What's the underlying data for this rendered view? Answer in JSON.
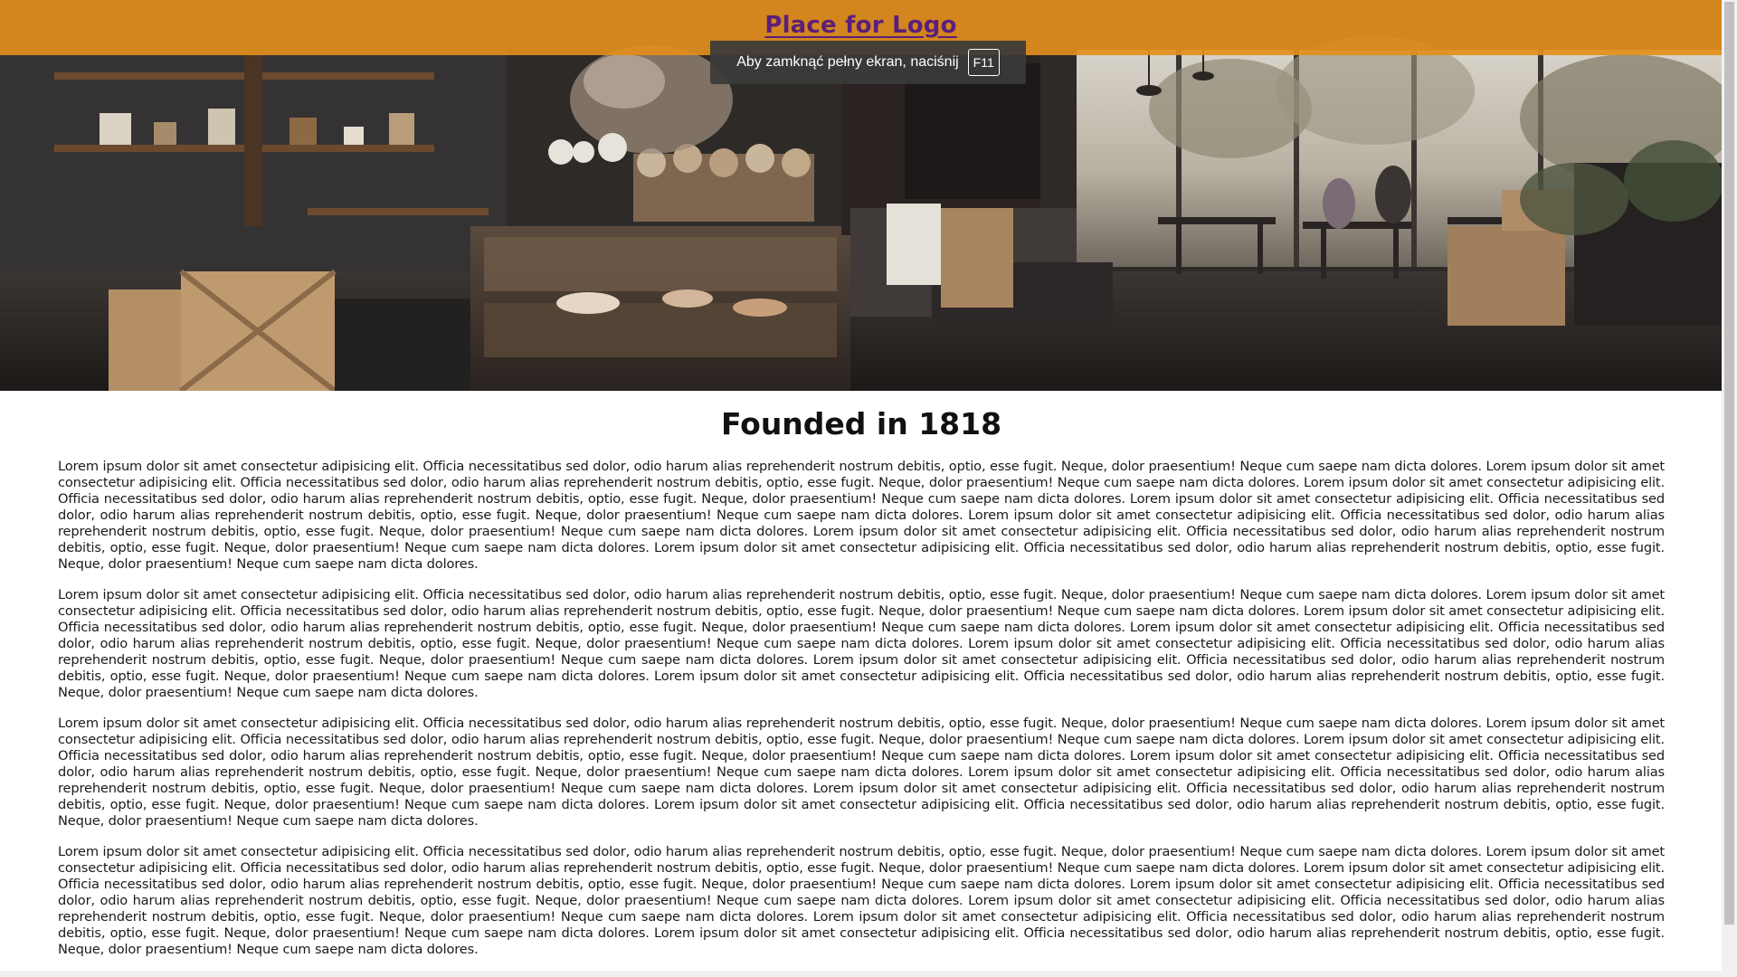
{
  "header": {
    "logo_text": "Place for Logo",
    "bar_color": "#e28e1c",
    "logo_color": "#5b1f7a"
  },
  "fullscreen_notice": {
    "message": "Aby zamknąć pełny ekran, naciśnij",
    "key": "F11"
  },
  "hero": {
    "image_icon": "coffee-shop-interior-image"
  },
  "main": {
    "title": "Founded in 1818",
    "paragraphs": [
      "Lorem ipsum dolor sit amet consectetur adipisicing elit. Officia necessitatibus sed dolor, odio harum alias reprehenderit nostrum debitis, optio, esse fugit. Neque, dolor praesentium! Neque cum saepe nam dicta dolores. Lorem ipsum dolor sit amet consectetur adipisicing elit. Officia necessitatibus sed dolor, odio harum alias reprehenderit nostrum debitis, optio, esse fugit. Neque, dolor praesentium! Neque cum saepe nam dicta dolores. Lorem ipsum dolor sit amet consectetur adipisicing elit. Officia necessitatibus sed dolor, odio harum alias reprehenderit nostrum debitis, optio, esse fugit. Neque, dolor praesentium! Neque cum saepe nam dicta dolores. Lorem ipsum dolor sit amet consectetur adipisicing elit. Officia necessitatibus sed dolor, odio harum alias reprehenderit nostrum debitis, optio, esse fugit. Neque, dolor praesentium! Neque cum saepe nam dicta dolores. Lorem ipsum dolor sit amet consectetur adipisicing elit. Officia necessitatibus sed dolor, odio harum alias reprehenderit nostrum debitis, optio, esse fugit. Neque, dolor praesentium! Neque cum saepe nam dicta dolores. Lorem ipsum dolor sit amet consectetur adipisicing elit. Officia necessitatibus sed dolor, odio harum alias reprehenderit nostrum debitis, optio, esse fugit. Neque, dolor praesentium! Neque cum saepe nam dicta dolores. Lorem ipsum dolor sit amet consectetur adipisicing elit. Officia necessitatibus sed dolor, odio harum alias reprehenderit nostrum debitis, optio, esse fugit. Neque, dolor praesentium! Neque cum saepe nam dicta dolores.",
      "Lorem ipsum dolor sit amet consectetur adipisicing elit. Officia necessitatibus sed dolor, odio harum alias reprehenderit nostrum debitis, optio, esse fugit. Neque, dolor praesentium! Neque cum saepe nam dicta dolores. Lorem ipsum dolor sit amet consectetur adipisicing elit. Officia necessitatibus sed dolor, odio harum alias reprehenderit nostrum debitis, optio, esse fugit. Neque, dolor praesentium! Neque cum saepe nam dicta dolores. Lorem ipsum dolor sit amet consectetur adipisicing elit. Officia necessitatibus sed dolor, odio harum alias reprehenderit nostrum debitis, optio, esse fugit. Neque, dolor praesentium! Neque cum saepe nam dicta dolores. Lorem ipsum dolor sit amet consectetur adipisicing elit. Officia necessitatibus sed dolor, odio harum alias reprehenderit nostrum debitis, optio, esse fugit. Neque, dolor praesentium! Neque cum saepe nam dicta dolores. Lorem ipsum dolor sit amet consectetur adipisicing elit. Officia necessitatibus sed dolor, odio harum alias reprehenderit nostrum debitis, optio, esse fugit. Neque, dolor praesentium! Neque cum saepe nam dicta dolores. Lorem ipsum dolor sit amet consectetur adipisicing elit. Officia necessitatibus sed dolor, odio harum alias reprehenderit nostrum debitis, optio, esse fugit. Neque, dolor praesentium! Neque cum saepe nam dicta dolores. Lorem ipsum dolor sit amet consectetur adipisicing elit. Officia necessitatibus sed dolor, odio harum alias reprehenderit nostrum debitis, optio, esse fugit. Neque, dolor praesentium! Neque cum saepe nam dicta dolores.",
      "Lorem ipsum dolor sit amet consectetur adipisicing elit. Officia necessitatibus sed dolor, odio harum alias reprehenderit nostrum debitis, optio, esse fugit. Neque, dolor praesentium! Neque cum saepe nam dicta dolores. Lorem ipsum dolor sit amet consectetur adipisicing elit. Officia necessitatibus sed dolor, odio harum alias reprehenderit nostrum debitis, optio, esse fugit. Neque, dolor praesentium! Neque cum saepe nam dicta dolores. Lorem ipsum dolor sit amet consectetur adipisicing elit. Officia necessitatibus sed dolor, odio harum alias reprehenderit nostrum debitis, optio, esse fugit. Neque, dolor praesentium! Neque cum saepe nam dicta dolores. Lorem ipsum dolor sit amet consectetur adipisicing elit. Officia necessitatibus sed dolor, odio harum alias reprehenderit nostrum debitis, optio, esse fugit. Neque, dolor praesentium! Neque cum saepe nam dicta dolores. Lorem ipsum dolor sit amet consectetur adipisicing elit. Officia necessitatibus sed dolor, odio harum alias reprehenderit nostrum debitis, optio, esse fugit. Neque, dolor praesentium! Neque cum saepe nam dicta dolores. Lorem ipsum dolor sit amet consectetur adipisicing elit. Officia necessitatibus sed dolor, odio harum alias reprehenderit nostrum debitis, optio, esse fugit. Neque, dolor praesentium! Neque cum saepe nam dicta dolores. Lorem ipsum dolor sit amet consectetur adipisicing elit. Officia necessitatibus sed dolor, odio harum alias reprehenderit nostrum debitis, optio, esse fugit. Neque, dolor praesentium! Neque cum saepe nam dicta dolores.",
      "Lorem ipsum dolor sit amet consectetur adipisicing elit. Officia necessitatibus sed dolor, odio harum alias reprehenderit nostrum debitis, optio, esse fugit. Neque, dolor praesentium! Neque cum saepe nam dicta dolores. Lorem ipsum dolor sit amet consectetur adipisicing elit. Officia necessitatibus sed dolor, odio harum alias reprehenderit nostrum debitis, optio, esse fugit. Neque, dolor praesentium! Neque cum saepe nam dicta dolores. Lorem ipsum dolor sit amet consectetur adipisicing elit. Officia necessitatibus sed dolor, odio harum alias reprehenderit nostrum debitis, optio, esse fugit. Neque, dolor praesentium! Neque cum saepe nam dicta dolores. Lorem ipsum dolor sit amet consectetur adipisicing elit. Officia necessitatibus sed dolor, odio harum alias reprehenderit nostrum debitis, optio, esse fugit. Neque, dolor praesentium! Neque cum saepe nam dicta dolores. Lorem ipsum dolor sit amet consectetur adipisicing elit. Officia necessitatibus sed dolor, odio harum alias reprehenderit nostrum debitis, optio, esse fugit. Neque, dolor praesentium! Neque cum saepe nam dicta dolores. Lorem ipsum dolor sit amet consectetur adipisicing elit. Officia necessitatibus sed dolor, odio harum alias reprehenderit nostrum debitis, optio, esse fugit. Neque, dolor praesentium! Neque cum saepe nam dicta dolores. Lorem ipsum dolor sit amet consectetur adipisicing elit. Officia necessitatibus sed dolor, odio harum alias reprehenderit nostrum debitis, optio, esse fugit. Neque, dolor praesentium! Neque cum saepe nam dicta dolores."
    ]
  }
}
